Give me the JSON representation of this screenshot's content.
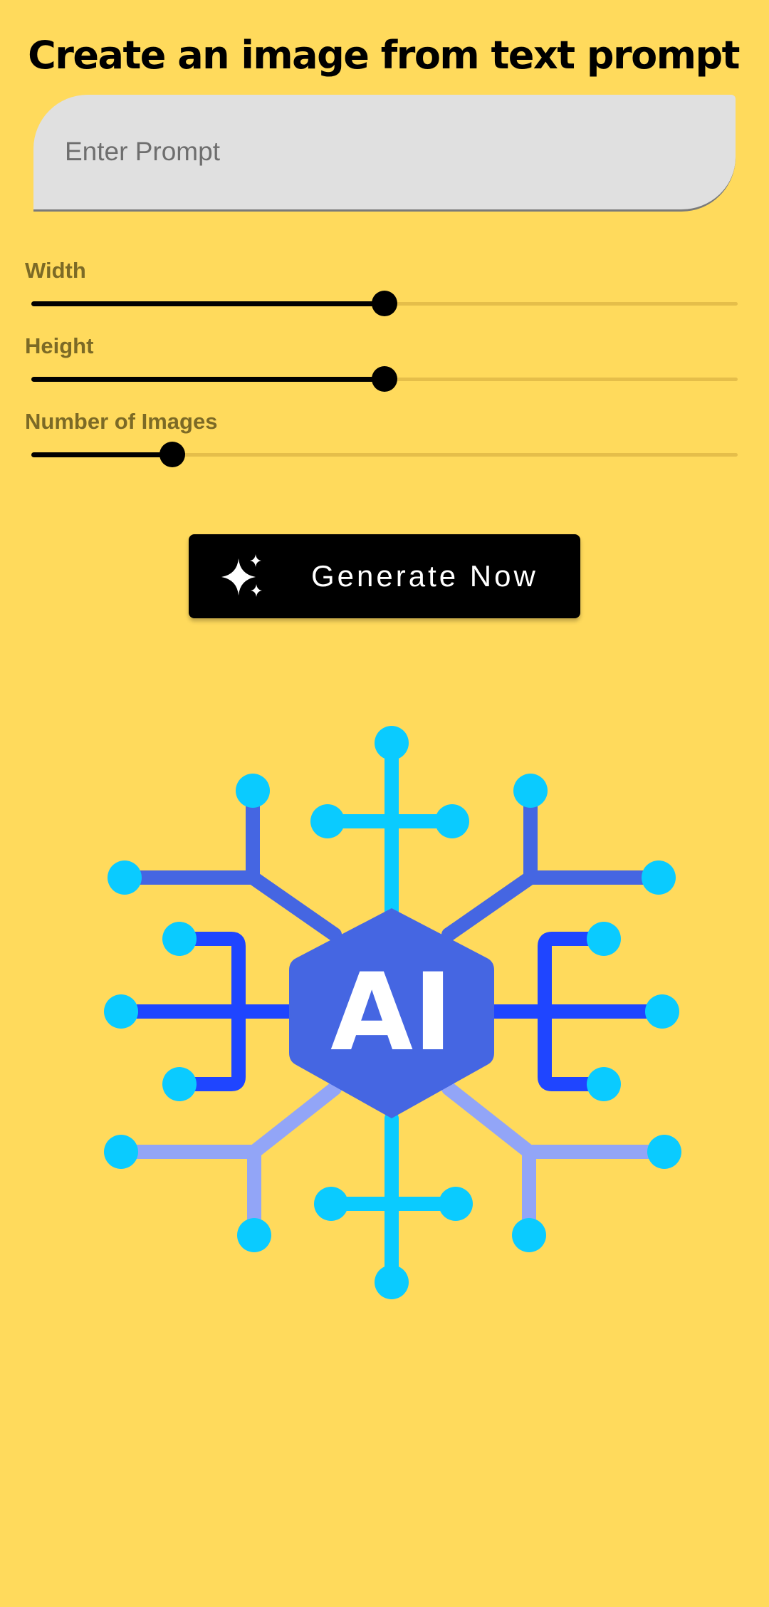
{
  "colors": {
    "background": "#FFDA5C",
    "input_background": "#E0E0E0",
    "slider_active": "#000000",
    "slider_inactive": "#E5BE4A",
    "label_text": "#7C6A26",
    "button_background": "#000000",
    "button_text": "#FFFFFF",
    "hex_blue": "#4566E2",
    "cyan": "#0ACBFF",
    "royal_blue": "#1F45FF",
    "light_blue": "#92A5F7"
  },
  "header": {
    "title": "Create an image from text prompt"
  },
  "prompt": {
    "placeholder": "Enter Prompt",
    "value": ""
  },
  "sliders": [
    {
      "label": "Width",
      "value_fraction": 0.5
    },
    {
      "label": "Height",
      "value_fraction": 0.5
    },
    {
      "label": "Number of Images",
      "value_fraction": 0.2
    }
  ],
  "generate": {
    "label": "Generate Now",
    "icon": "sparkles-icon"
  },
  "illustration": {
    "icon": "ai-network-icon",
    "text": "AI"
  }
}
